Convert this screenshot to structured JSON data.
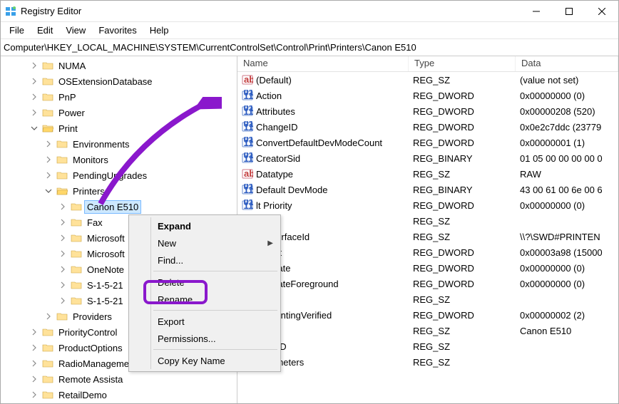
{
  "window": {
    "title": "Registry Editor"
  },
  "menu": {
    "file": "File",
    "edit": "Edit",
    "view": "View",
    "favorites": "Favorites",
    "help": "Help"
  },
  "address": "Computer\\HKEY_LOCAL_MACHINE\\SYSTEM\\CurrentControlSet\\Control\\Print\\Printers\\Canon E510",
  "tree": {
    "items": [
      {
        "indent": 42,
        "chev": "r",
        "label": "NUMA"
      },
      {
        "indent": 42,
        "chev": "r",
        "label": "OSExtensionDatabase"
      },
      {
        "indent": 42,
        "chev": "r",
        "label": "PnP"
      },
      {
        "indent": 42,
        "chev": "r",
        "label": "Power"
      },
      {
        "indent": 42,
        "chev": "d",
        "label": "Print",
        "open": true
      },
      {
        "indent": 62,
        "chev": "r",
        "label": "Environments"
      },
      {
        "indent": 62,
        "chev": "r",
        "label": "Monitors"
      },
      {
        "indent": 62,
        "chev": "r",
        "label": "PendingUpgrades"
      },
      {
        "indent": 62,
        "chev": "d",
        "label": "Printers",
        "open": true
      },
      {
        "indent": 82,
        "chev": "r",
        "label": "Canon E510",
        "selected": true
      },
      {
        "indent": 82,
        "chev": "r",
        "label": "Fax"
      },
      {
        "indent": 82,
        "chev": "r",
        "label": "Microsoft"
      },
      {
        "indent": 82,
        "chev": "r",
        "label": "Microsoft"
      },
      {
        "indent": 82,
        "chev": "r",
        "label": "OneNote"
      },
      {
        "indent": 82,
        "chev": "r",
        "label": "S-1-5-21"
      },
      {
        "indent": 82,
        "chev": "r",
        "label": "S-1-5-21"
      },
      {
        "indent": 62,
        "chev": "r",
        "label": "Providers"
      },
      {
        "indent": 42,
        "chev": "r",
        "label": "PriorityControl"
      },
      {
        "indent": 42,
        "chev": "r",
        "label": "ProductOptions"
      },
      {
        "indent": 42,
        "chev": "r",
        "label": "RadioManagement"
      },
      {
        "indent": 42,
        "chev": "r",
        "label": "Remote Assista"
      },
      {
        "indent": 42,
        "chev": "r",
        "label": "RetailDemo"
      }
    ]
  },
  "listhead": {
    "name": "Name",
    "type": "Type",
    "data": "Data"
  },
  "values": [
    {
      "icon": "str",
      "name": "(Default)",
      "type": "REG_SZ",
      "data": "(value not set)"
    },
    {
      "icon": "bin",
      "name": "Action",
      "type": "REG_DWORD",
      "data": "0x00000000 (0)"
    },
    {
      "icon": "bin",
      "name": "Attributes",
      "type": "REG_DWORD",
      "data": "0x00000208 (520)"
    },
    {
      "icon": "bin",
      "name": "ChangeID",
      "type": "REG_DWORD",
      "data": "0x0e2c7ddc (23779"
    },
    {
      "icon": "bin",
      "name": "ConvertDefaultDevModeCount",
      "type": "REG_DWORD",
      "data": "0x00000001 (1)"
    },
    {
      "icon": "bin",
      "name": "CreatorSid",
      "type": "REG_BINARY",
      "data": "01 05 00 00 00 00 0"
    },
    {
      "icon": "str",
      "name": "Datatype",
      "type": "REG_SZ",
      "data": "RAW"
    },
    {
      "icon": "bin",
      "name": "Default DevMode",
      "type": "REG_BINARY",
      "data": "43 00 61 00 6e 00 6"
    },
    {
      "icon": "bin",
      "name": "lt Priority",
      "type": "REG_DWORD",
      "data": "0x00000000 (0)"
    },
    {
      "icon": "str",
      "name": "ription",
      "type": "REG_SZ",
      "data": ""
    },
    {
      "icon": "str",
      "name": "ceInterfaceId",
      "type": "REG_SZ",
      "data": "\\\\?\\SWD#PRINTEN"
    },
    {
      "icon": "bin",
      "name": "meout",
      "type": "REG_DWORD",
      "data": "0x00003a98 (15000"
    },
    {
      "icon": "bin",
      "name": "yUpdate",
      "type": "REG_DWORD",
      "data": "0x00000000 (0)"
    },
    {
      "icon": "bin",
      "name": "yUpdateForeground",
      "type": "REG_DWORD",
      "data": "0x00000000 (0)"
    },
    {
      "icon": "str",
      "name": "tion",
      "type": "REG_SZ",
      "data": ""
    },
    {
      "icon": "bin",
      "name": "ernPrintingVerified",
      "type": "REG_DWORD",
      "data": "0x00000002 (2)"
    },
    {
      "icon": "str",
      "name": "e",
      "type": "REG_SZ",
      "data": "Canon E510"
    },
    {
      "icon": "str",
      "name": "ctGUID",
      "type": "REG_SZ",
      "data": ""
    },
    {
      "icon": "str",
      "name": "Parameters",
      "type": "REG_SZ",
      "data": ""
    }
  ],
  "context": {
    "expand": "Expand",
    "new": "New",
    "find": "Find...",
    "delete": "Delete",
    "rename": "Rename",
    "export": "Export",
    "permissions": "Permissions...",
    "copykey": "Copy Key Name"
  }
}
